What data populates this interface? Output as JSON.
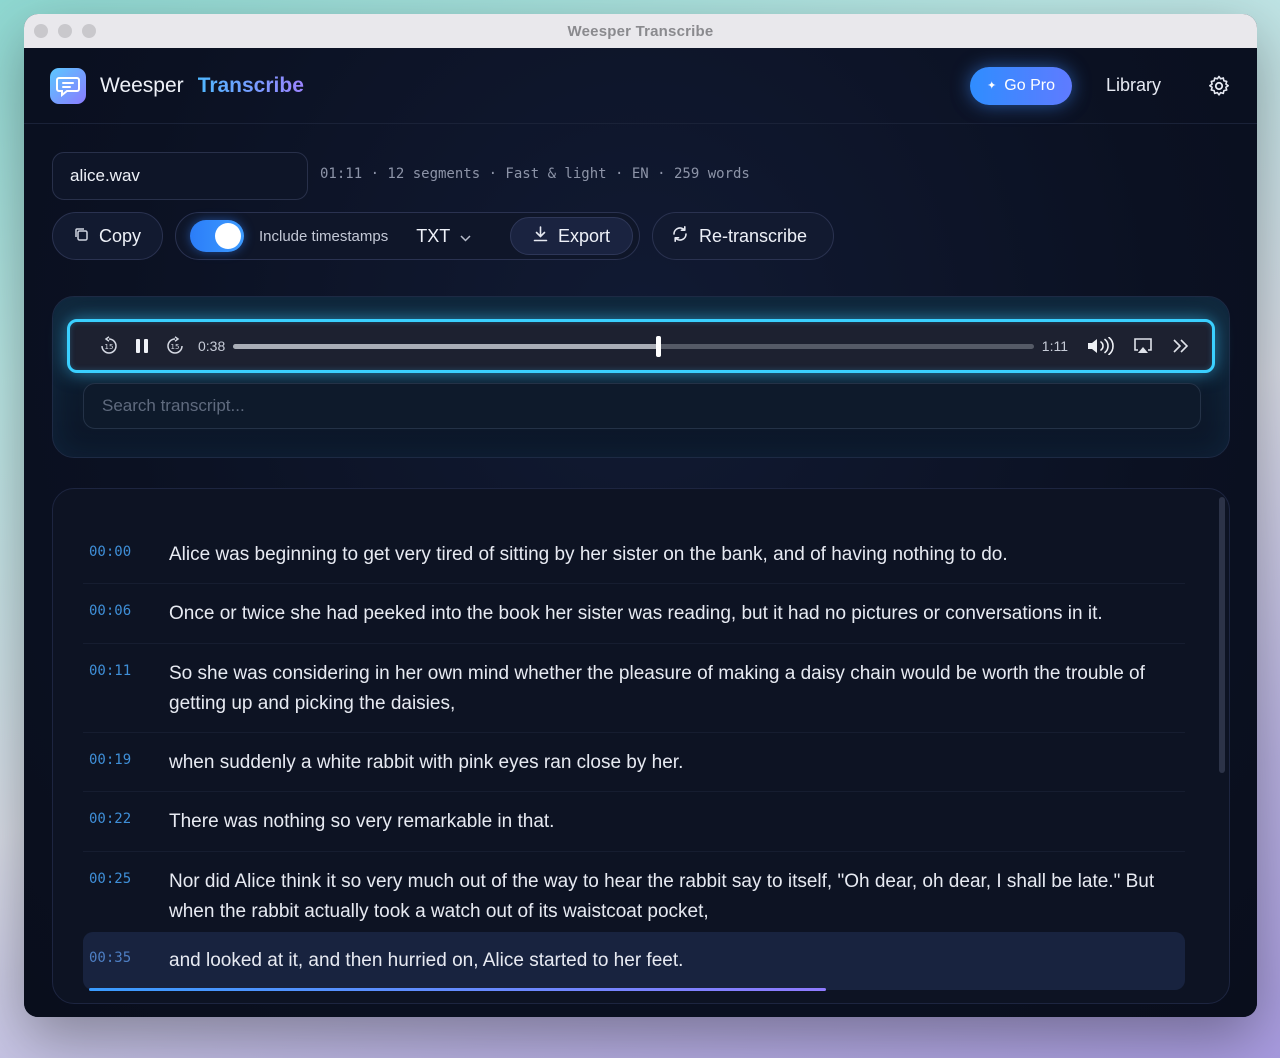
{
  "window": {
    "title": "Weesper Transcribe"
  },
  "header": {
    "brand": "Weesper",
    "brand_accent": "Transcribe",
    "go_pro": "Go Pro",
    "library": "Library"
  },
  "file": {
    "name": "alice.wav",
    "meta": "01:11 · 12 segments · Fast & light · EN · 259 words"
  },
  "toolbar": {
    "copy": "Copy",
    "include_timestamps": "Include timestamps",
    "timestamps_on": true,
    "format": "TXT",
    "export": "Export",
    "retranscribe": "Re-transcribe"
  },
  "player": {
    "current": "0:38",
    "duration": "1:11",
    "progress_fraction": 0.53
  },
  "search": {
    "placeholder": "Search transcript..."
  },
  "segments": [
    {
      "ts": "00:00",
      "text": "Alice was beginning to get very tired of sitting by her sister on the bank, and of having nothing to do."
    },
    {
      "ts": "00:06",
      "text": "Once or twice she had peeked into the book her sister was reading, but it had no pictures or conversations in it."
    },
    {
      "ts": "00:11",
      "text": "So she was considering in her own mind whether the pleasure of making a daisy chain would be worth the trouble of getting up and picking the daisies,"
    },
    {
      "ts": "00:19",
      "text": "when suddenly a white rabbit with pink eyes ran close by her."
    },
    {
      "ts": "00:22",
      "text": "There was nothing so very remarkable in that."
    },
    {
      "ts": "00:25",
      "text": "Nor did Alice think it so very much out of the way to hear the rabbit say to itself, \"Oh dear, oh dear, I shall be late.\" But when the rabbit actually took a watch out of its waistcoat pocket,"
    },
    {
      "ts": "00:35",
      "text": "and looked at it, and then hurried on, Alice started to her feet."
    }
  ],
  "active_segment_progress": 0.67,
  "colors": {
    "accent": "#3ad0ff",
    "brand_blue": "#2f8dff",
    "brand_purple": "#9b83ff",
    "timestamp": "#3f8fd8"
  }
}
